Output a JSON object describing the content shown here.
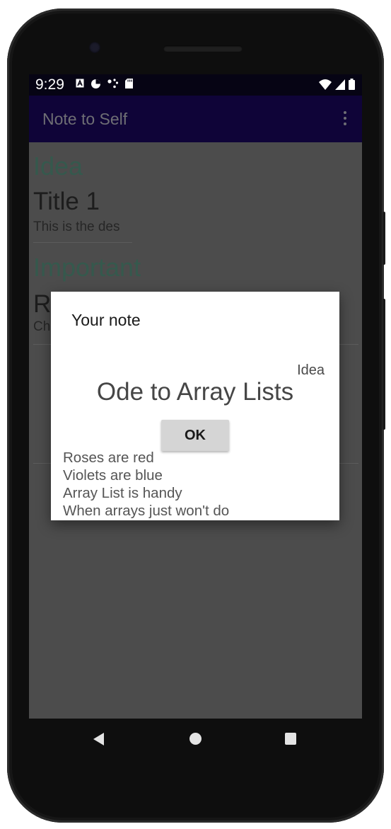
{
  "status_bar": {
    "time": "9:29",
    "left_icons": [
      "a-icon",
      "data-saver-icon",
      "cast-icon",
      "sd-card-icon"
    ],
    "right_icons": [
      "wifi-icon",
      "signal-icon",
      "battery-icon"
    ]
  },
  "app_bar": {
    "title": "Note to Self"
  },
  "notes": [
    {
      "type": "Idea",
      "title": "Title 1",
      "description": "This is the des"
    },
    {
      "type": "Important",
      "title": "R",
      "description": "Ch"
    }
  ],
  "dialog": {
    "title": "Your note",
    "note_type": "Idea",
    "note_title": "Ode to Array Lists",
    "ok_label": "OK",
    "body_lines": [
      "Roses are red",
      "Violets are blue",
      "Array List is handy",
      "When arrays just won't do"
    ]
  },
  "fab": {
    "icon": "mail-icon"
  },
  "nav_bar": {
    "icons": [
      "back-icon",
      "home-icon",
      "recents-icon"
    ]
  },
  "colors": {
    "app_bar": "#0f0438",
    "status_bar": "#060414",
    "note_type": "#35594d",
    "scrim_background": "#4c4c4c",
    "fab": "#1f4a44"
  }
}
